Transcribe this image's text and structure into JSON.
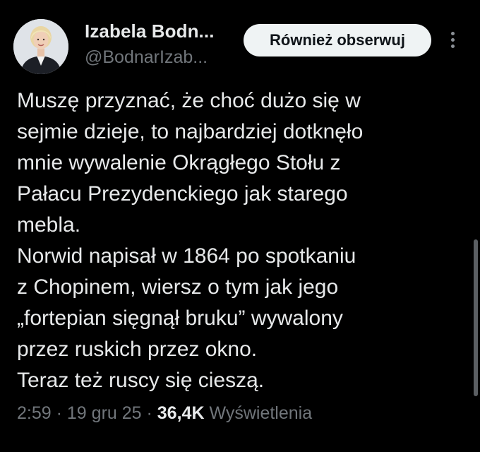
{
  "author": {
    "display_name": "Izabela Bodn...",
    "handle": "@BodnarIzab...",
    "avatar_icon": "profile-photo"
  },
  "actions": {
    "follow_label": "Również obserwuj",
    "more_icon": "more-vertical-icon"
  },
  "tweet": {
    "lines": [
      "Muszę przyznać, że choć dużo się w",
      "sejmie dzieje, to najbardziej dotknęło",
      "mnie wywalenie Okrągłego Stołu z",
      "Pałacu Prezydenckiego jak starego",
      "mebla.",
      "Norwid napisał w 1864 po spotkaniu",
      "z Chopinem, wiersz o tym jak jego",
      "„fortepian sięgnął bruku” wywalony",
      "przez ruskich przez okno.",
      "Teraz też ruscy się cieszą."
    ]
  },
  "meta": {
    "time": "2:59",
    "separator": "·",
    "date": "19 gru 25",
    "views_count": "36,4K",
    "views_label": "Wyświetlenia"
  },
  "colors": {
    "background": "#000000",
    "text_primary": "#e7e9ea",
    "text_secondary": "#71767b",
    "button_bg": "#eff3f4",
    "button_text": "#0f1419"
  }
}
